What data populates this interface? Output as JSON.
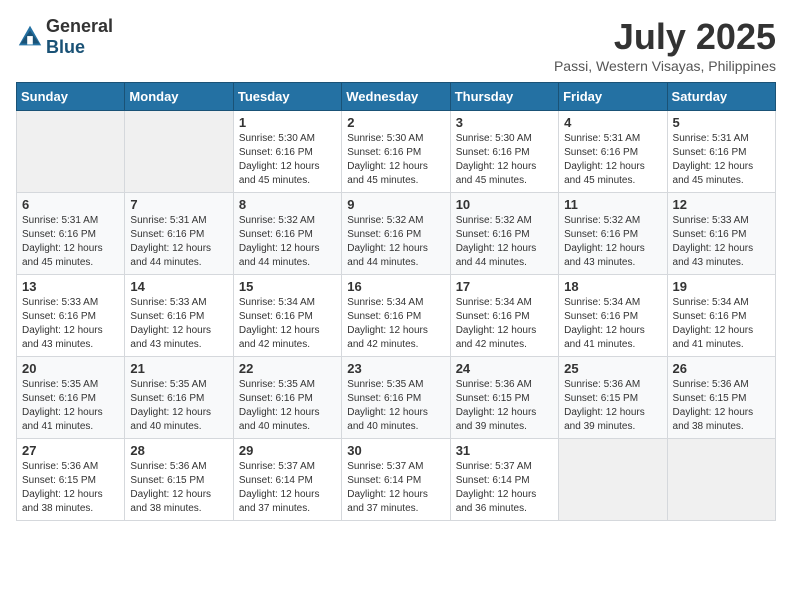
{
  "header": {
    "logo_general": "General",
    "logo_blue": "Blue",
    "month_year": "July 2025",
    "location": "Passi, Western Visayas, Philippines"
  },
  "weekdays": [
    "Sunday",
    "Monday",
    "Tuesday",
    "Wednesday",
    "Thursday",
    "Friday",
    "Saturday"
  ],
  "weeks": [
    [
      {
        "day": "",
        "info": ""
      },
      {
        "day": "",
        "info": ""
      },
      {
        "day": "1",
        "info": "Sunrise: 5:30 AM\nSunset: 6:16 PM\nDaylight: 12 hours and 45 minutes."
      },
      {
        "day": "2",
        "info": "Sunrise: 5:30 AM\nSunset: 6:16 PM\nDaylight: 12 hours and 45 minutes."
      },
      {
        "day": "3",
        "info": "Sunrise: 5:30 AM\nSunset: 6:16 PM\nDaylight: 12 hours and 45 minutes."
      },
      {
        "day": "4",
        "info": "Sunrise: 5:31 AM\nSunset: 6:16 PM\nDaylight: 12 hours and 45 minutes."
      },
      {
        "day": "5",
        "info": "Sunrise: 5:31 AM\nSunset: 6:16 PM\nDaylight: 12 hours and 45 minutes."
      }
    ],
    [
      {
        "day": "6",
        "info": "Sunrise: 5:31 AM\nSunset: 6:16 PM\nDaylight: 12 hours and 45 minutes."
      },
      {
        "day": "7",
        "info": "Sunrise: 5:31 AM\nSunset: 6:16 PM\nDaylight: 12 hours and 44 minutes."
      },
      {
        "day": "8",
        "info": "Sunrise: 5:32 AM\nSunset: 6:16 PM\nDaylight: 12 hours and 44 minutes."
      },
      {
        "day": "9",
        "info": "Sunrise: 5:32 AM\nSunset: 6:16 PM\nDaylight: 12 hours and 44 minutes."
      },
      {
        "day": "10",
        "info": "Sunrise: 5:32 AM\nSunset: 6:16 PM\nDaylight: 12 hours and 44 minutes."
      },
      {
        "day": "11",
        "info": "Sunrise: 5:32 AM\nSunset: 6:16 PM\nDaylight: 12 hours and 43 minutes."
      },
      {
        "day": "12",
        "info": "Sunrise: 5:33 AM\nSunset: 6:16 PM\nDaylight: 12 hours and 43 minutes."
      }
    ],
    [
      {
        "day": "13",
        "info": "Sunrise: 5:33 AM\nSunset: 6:16 PM\nDaylight: 12 hours and 43 minutes."
      },
      {
        "day": "14",
        "info": "Sunrise: 5:33 AM\nSunset: 6:16 PM\nDaylight: 12 hours and 43 minutes."
      },
      {
        "day": "15",
        "info": "Sunrise: 5:34 AM\nSunset: 6:16 PM\nDaylight: 12 hours and 42 minutes."
      },
      {
        "day": "16",
        "info": "Sunrise: 5:34 AM\nSunset: 6:16 PM\nDaylight: 12 hours and 42 minutes."
      },
      {
        "day": "17",
        "info": "Sunrise: 5:34 AM\nSunset: 6:16 PM\nDaylight: 12 hours and 42 minutes."
      },
      {
        "day": "18",
        "info": "Sunrise: 5:34 AM\nSunset: 6:16 PM\nDaylight: 12 hours and 41 minutes."
      },
      {
        "day": "19",
        "info": "Sunrise: 5:34 AM\nSunset: 6:16 PM\nDaylight: 12 hours and 41 minutes."
      }
    ],
    [
      {
        "day": "20",
        "info": "Sunrise: 5:35 AM\nSunset: 6:16 PM\nDaylight: 12 hours and 41 minutes."
      },
      {
        "day": "21",
        "info": "Sunrise: 5:35 AM\nSunset: 6:16 PM\nDaylight: 12 hours and 40 minutes."
      },
      {
        "day": "22",
        "info": "Sunrise: 5:35 AM\nSunset: 6:16 PM\nDaylight: 12 hours and 40 minutes."
      },
      {
        "day": "23",
        "info": "Sunrise: 5:35 AM\nSunset: 6:16 PM\nDaylight: 12 hours and 40 minutes."
      },
      {
        "day": "24",
        "info": "Sunrise: 5:36 AM\nSunset: 6:15 PM\nDaylight: 12 hours and 39 minutes."
      },
      {
        "day": "25",
        "info": "Sunrise: 5:36 AM\nSunset: 6:15 PM\nDaylight: 12 hours and 39 minutes."
      },
      {
        "day": "26",
        "info": "Sunrise: 5:36 AM\nSunset: 6:15 PM\nDaylight: 12 hours and 38 minutes."
      }
    ],
    [
      {
        "day": "27",
        "info": "Sunrise: 5:36 AM\nSunset: 6:15 PM\nDaylight: 12 hours and 38 minutes."
      },
      {
        "day": "28",
        "info": "Sunrise: 5:36 AM\nSunset: 6:15 PM\nDaylight: 12 hours and 38 minutes."
      },
      {
        "day": "29",
        "info": "Sunrise: 5:37 AM\nSunset: 6:14 PM\nDaylight: 12 hours and 37 minutes."
      },
      {
        "day": "30",
        "info": "Sunrise: 5:37 AM\nSunset: 6:14 PM\nDaylight: 12 hours and 37 minutes."
      },
      {
        "day": "31",
        "info": "Sunrise: 5:37 AM\nSunset: 6:14 PM\nDaylight: 12 hours and 36 minutes."
      },
      {
        "day": "",
        "info": ""
      },
      {
        "day": "",
        "info": ""
      }
    ]
  ]
}
